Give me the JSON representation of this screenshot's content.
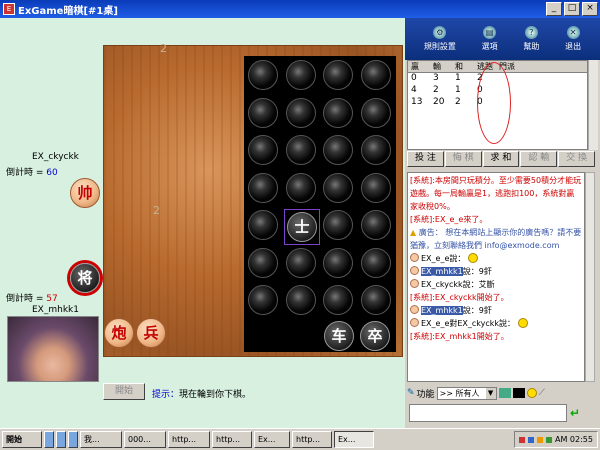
{
  "window": {
    "title": "ExGame暗棋[#1桌]",
    "minimize": "_",
    "maximize": "□",
    "close": "×"
  },
  "board": {
    "top_number": "2",
    "mid_number": "2",
    "hidden_pieces": 16,
    "selected_piece": "士",
    "black_pieces": [
      "车",
      "卒"
    ],
    "red_pieces": [
      "炮",
      "兵"
    ]
  },
  "players": {
    "top": {
      "name": "EX_ckyckk",
      "timer_label": "倒計時 =",
      "timer_value": "60",
      "piece": "帅"
    },
    "bottom": {
      "name": "EX_mhkk1",
      "timer_label": "倒計時 =",
      "timer_value": "57",
      "piece": "将"
    }
  },
  "start_button": "開始",
  "hint": {
    "label": "提示：",
    "text": "現在輪到你下棋。"
  },
  "toolbar": [
    {
      "label": "規則設置",
      "icon": "settings-icon"
    },
    {
      "label": "選項",
      "icon": "options-icon"
    },
    {
      "label": "幫助",
      "icon": "help-icon"
    },
    {
      "label": "退出",
      "icon": "exit-icon"
    }
  ],
  "stats": {
    "headers": [
      "贏",
      "輸",
      "和",
      "逃跑",
      "門派"
    ],
    "rows": [
      [
        "0",
        "3",
        "1",
        "2",
        ""
      ],
      [
        "4",
        "2",
        "1",
        "0",
        ""
      ],
      [
        "13",
        "20",
        "2",
        "0",
        ""
      ]
    ]
  },
  "actions": [
    "投 注",
    "悔 棋",
    "求 和",
    "認 輸",
    "交 換"
  ],
  "chat": {
    "system1": "[系統]:本房間只玩積分。至少需要50積分才能玩遊戲。每一局輸贏是1，逃跑扣100，系統對贏家收稅0%。",
    "system2": "[系統]:EX_e_e來了。",
    "ad": "廣告： 想在本網站上顯示你的廣告嗎？請不要猶豫，立刻聯絡我們 info@exmode.com",
    "line1": "EX_e_e說：",
    "line2_user": "EX_mhkk1",
    "line2_text": "說：9釬",
    "line3": "EX_ckyckk說：艾斷",
    "system3": "[系統]:EX_ckyckk開始了。",
    "line4_user": "EX_mhkk1",
    "line4_text": "說：9釬",
    "line5": "EX_e_e對EX_ckyckk說：",
    "system4": "[系統]:EX_mhkk1開始了。"
  },
  "chat_controls": {
    "func": "功能",
    "target": ">> 所有人"
  },
  "taskbar": {
    "start": "開始",
    "items": [
      "我...",
      "000...",
      "http...",
      "http...",
      "Ex...",
      "http...",
      "Ex..."
    ],
    "clock": "AM 02:55"
  }
}
